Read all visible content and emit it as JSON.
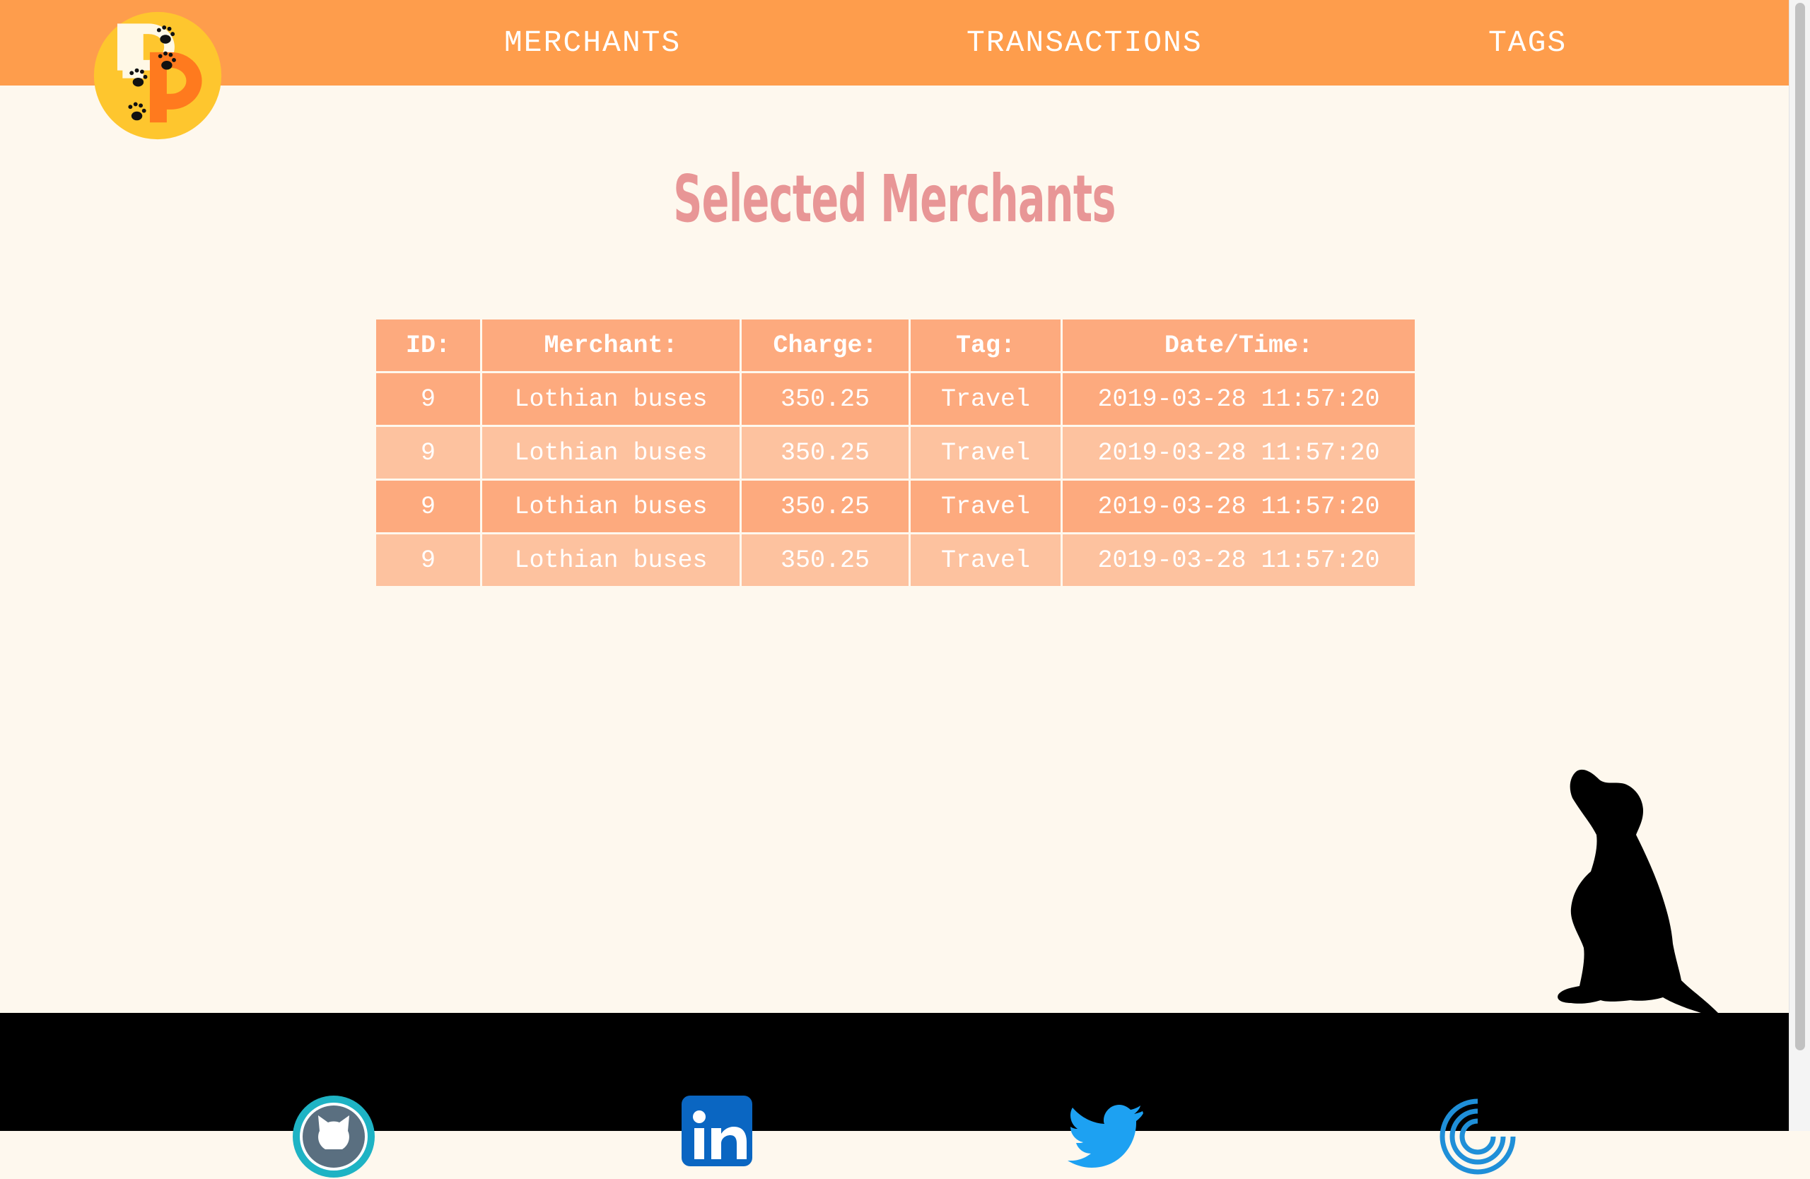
{
  "nav": {
    "merchants": "MERCHANTS",
    "transactions": "TRANSACTIONS",
    "tags": "TAGS"
  },
  "page": {
    "title": "Selected Merchants"
  },
  "table": {
    "headers": [
      "ID:",
      "Merchant:",
      "Charge:",
      "Tag:",
      "Date/Time:"
    ],
    "rows": [
      [
        "9",
        "Lothian buses",
        "350.25",
        "Travel",
        "2019-03-28 11:57:20"
      ],
      [
        "9",
        "Lothian buses",
        "350.25",
        "Travel",
        "2019-03-28 11:57:20"
      ],
      [
        "9",
        "Lothian buses",
        "350.25",
        "Travel",
        "2019-03-28 11:57:20"
      ],
      [
        "9",
        "Lothian buses",
        "350.25",
        "Travel",
        "2019-03-28 11:57:20"
      ]
    ]
  },
  "footer": {
    "icons": [
      "github-icon",
      "linkedin-icon",
      "twitter-icon",
      "portfolio-icon"
    ]
  },
  "colors": {
    "navbar": "#fe9d4c",
    "background": "#fef8ee",
    "title": "#e89696",
    "row_dark": "#fdaa7e",
    "row_light": "#fdc29f",
    "footer": "#000000"
  }
}
